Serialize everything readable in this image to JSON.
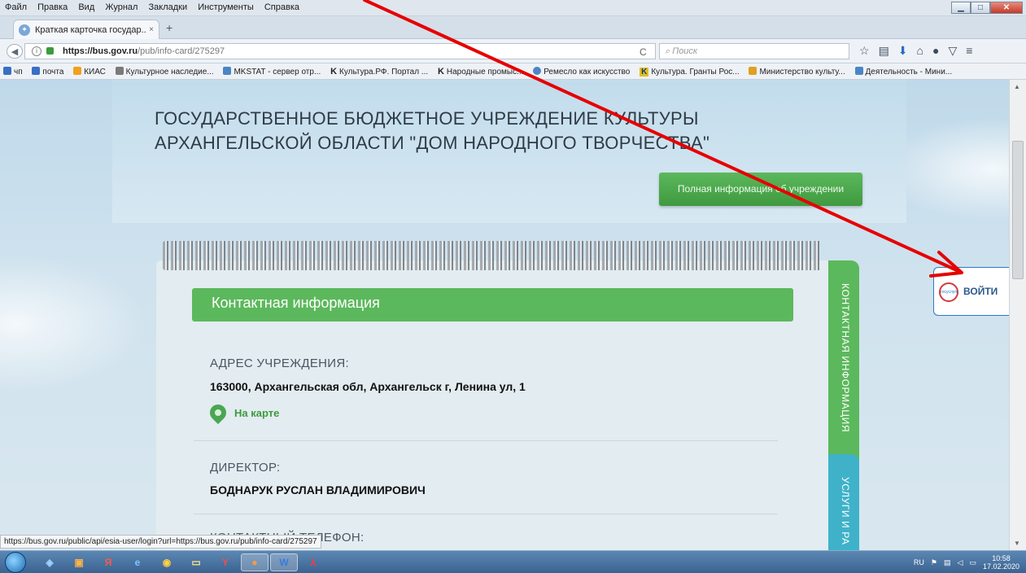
{
  "menu": {
    "items": [
      "Файл",
      "Правка",
      "Вид",
      "Журнал",
      "Закладки",
      "Инструменты",
      "Справка"
    ]
  },
  "tab": {
    "title": "Краткая карточка государ...",
    "close": "×",
    "new_tab": "+"
  },
  "nav": {
    "url_host": "https://bus.gov.ru",
    "url_path": "/pub/info-card/275297",
    "search_placeholder": "Поиск"
  },
  "bookmarks": [
    {
      "label": "чп",
      "color": "#3a6fc4"
    },
    {
      "label": "почта",
      "color": "#3a6fc4"
    },
    {
      "label": "КИАС",
      "color": "#f2a01c"
    },
    {
      "label": "Культурное наследие...",
      "color": "#7a7a7a"
    },
    {
      "label": "MKSTAT - сервер отр...",
      "color": "#4a86c5"
    },
    {
      "label": "Культура.РФ. Портал ...",
      "color": "#222222"
    },
    {
      "label": "Народные промыс...",
      "color": "#222222"
    },
    {
      "label": "Ремесло как искусство",
      "color": "#4a86c5"
    },
    {
      "label": "Культура. Гранты Рос...",
      "color": "#e0c020"
    },
    {
      "label": "Министерство культу...",
      "color": "#e0a020"
    },
    {
      "label": "Деятельность - Мини...",
      "color": "#4a86c5"
    }
  ],
  "page": {
    "title_line1": "ГОСУДАРСТВЕННОЕ БЮДЖЕТНОЕ УЧРЕЖДЕНИЕ КУЛЬТУРЫ",
    "title_line2": "АРХАНГЕЛЬСКОЙ ОБЛАСТИ \"ДОМ НАРОДНОГО ТВОРЧЕСТВА\"",
    "full_info_button": "Полная информация об учреждении",
    "contact_header": "Контактная информация",
    "address_label": "АДРЕС УЧРЕЖДЕНИЯ:",
    "address_value": "163000, Архангельская обл, Архангельск г, Ленина ул, 1",
    "map_link": "На карте",
    "director_label": "ДИРЕКТОР:",
    "director_value": "БОДНАРУК РУСЛАН ВЛАДИМИРОВИЧ",
    "phone_label": "КОНТАКТНЫЙ ТЕЛЕФОН:",
    "side_tab_contacts": "КОНТАКТНАЯ ИНФОРМАЦИЯ",
    "side_tab_services": "УСЛУГИ И РА",
    "login_button": "ВОЙТИ",
    "login_logo": "госуслуги"
  },
  "status_url": "https://bus.gov.ru/public/api/esia-user/login?url=https://bus.gov.ru/pub/info-card/275297",
  "taskbar": {
    "lang": "RU",
    "time": "10:58",
    "date": "17.02.2020"
  },
  "colors": {
    "accent_green": "#5cb85c",
    "accent_blue": "#3fb2c9",
    "annotation_arrow": "#e60000"
  }
}
